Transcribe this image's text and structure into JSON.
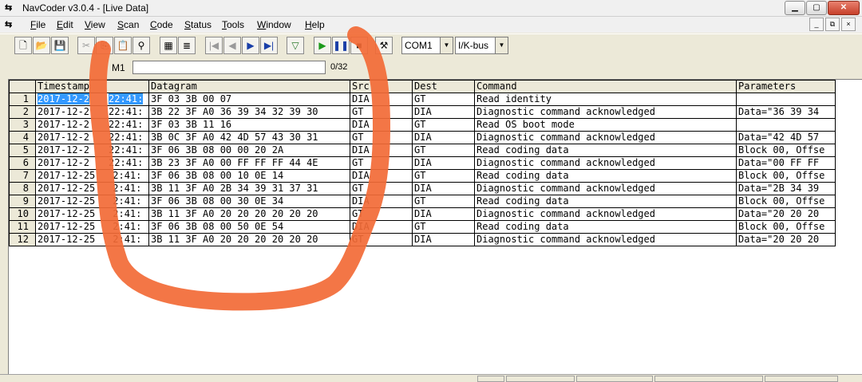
{
  "window": {
    "title": "NavCoder v3.0.4 - [Live Data]"
  },
  "menu": [
    {
      "ul": "F",
      "rest": "ile"
    },
    {
      "ul": "E",
      "rest": "dit"
    },
    {
      "ul": "V",
      "rest": "iew"
    },
    {
      "ul": "S",
      "rest": "can"
    },
    {
      "ul": "C",
      "rest": "ode"
    },
    {
      "ul": "S",
      "rest": "tatus"
    },
    {
      "ul": "T",
      "rest": "ools"
    },
    {
      "ul": "W",
      "rest": "indow"
    },
    {
      "ul": "H",
      "rest": "elp"
    }
  ],
  "toolbar": {
    "port": "COM1",
    "bus": "I/K-bus"
  },
  "status": {
    "port_label": "M1",
    "progress_text": "0/32",
    "progress": 0
  },
  "columns": [
    "Timestamp",
    "Datagram",
    "Src",
    "Dest",
    "Command",
    "Parameters"
  ],
  "rows": [
    {
      "n": "1",
      "ts": "2017-12-2",
      "ts2": "22:41:",
      "dg": "3F 03 3B 00 07",
      "src": "DIA",
      "dest": "GT",
      "cmd": "Read identity",
      "par": ""
    },
    {
      "n": "2",
      "ts": "2017-12-2",
      "ts2": "22:41:",
      "dg": "3B 22 3F A0 36 39 34 32 39 30",
      "src": "GT",
      "dest": "DIA",
      "cmd": "Diagnostic command acknowledged",
      "par": "Data=\"36 39 34"
    },
    {
      "n": "3",
      "ts": "2017-12-2",
      "ts2": "22:41:",
      "dg": "3F 03 3B 11 16",
      "src": "DIA",
      "dest": "GT",
      "cmd": "Read OS boot mode",
      "par": ""
    },
    {
      "n": "4",
      "ts": "2017-12-2",
      "ts2": "22:41:",
      "dg": "3B 0C 3F A0 42 4D 57 43 30 31",
      "src": "GT",
      "dest": "DIA",
      "cmd": "Diagnostic command acknowledged",
      "par": "Data=\"42 4D 57"
    },
    {
      "n": "5",
      "ts": "2017-12-2",
      "ts2": "22:41:",
      "dg": "3F 06 3B 08 00 00 20 2A",
      "src": "DIA",
      "dest": "GT",
      "cmd": "Read coding data",
      "par": "Block 00, Offse"
    },
    {
      "n": "6",
      "ts": "2017-12-2",
      "ts2": "22:41:",
      "dg": "3B 23 3F A0 00 FF FF FF 44 4E",
      "src": "GT",
      "dest": "DIA",
      "cmd": "Diagnostic command acknowledged",
      "par": "Data=\"00 FF FF"
    },
    {
      "n": "7",
      "ts": "2017-12-25",
      "ts2": "2:41:",
      "dg": "3F 06 3B 08 00 10 0E 14",
      "src": "DIA",
      "dest": "GT",
      "cmd": "Read coding data",
      "par": "Block 00, Offse"
    },
    {
      "n": "8",
      "ts": "2017-12-25",
      "ts2": "2:41:",
      "dg": "3B 11 3F A0 2B 34 39 31 37 31",
      "src": "GT",
      "dest": "DIA",
      "cmd": "Diagnostic command acknowledged",
      "par": "Data=\"2B 34 39"
    },
    {
      "n": "9",
      "ts": "2017-12-25",
      "ts2": "2:41:",
      "dg": "3F 06 3B 08 00 30 0E 34",
      "src": "DIA",
      "dest": "GT",
      "cmd": "Read coding data",
      "par": "Block 00, Offse"
    },
    {
      "n": "10",
      "ts": "2017-12-25",
      "ts2": "2:41:",
      "dg": "3B 11 3F A0 20 20 20 20 20 20",
      "src": "GT",
      "dest": "DIA",
      "cmd": "Diagnostic command acknowledged",
      "par": "Data=\"20 20 20"
    },
    {
      "n": "11",
      "ts": "2017-12-25",
      "ts2": "2:41:",
      "dg": "3F 06 3B 08 00 50 0E 54",
      "src": "DIA",
      "dest": "GT",
      "cmd": "Read coding data",
      "par": "Block 00, Offse"
    },
    {
      "n": "12",
      "ts": "2017-12-25",
      "ts2": "2:41:",
      "dg": "3B 11 3F A0 20 20 20 20 20 20",
      "src": "GT",
      "dest": "DIA",
      "cmd": "Diagnostic command acknowledged",
      "par": "Data=\"20 20 20"
    }
  ],
  "colors": {
    "selection": "#3399ff",
    "scribble": "#f26a36",
    "progress": "#3a6fd8"
  }
}
